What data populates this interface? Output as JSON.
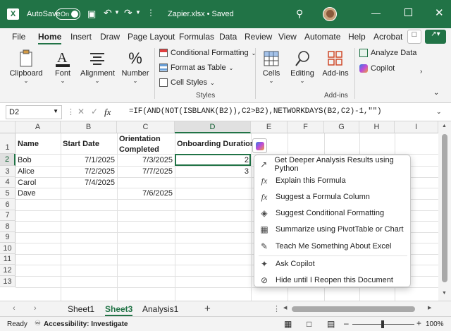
{
  "titlebar": {
    "autosave_label": "AutoSave",
    "autosave_state": "On",
    "doc_title": "Zapier.xlsx • Saved"
  },
  "menu_tabs": [
    "File",
    "Home",
    "Insert",
    "Draw",
    "Page Layout",
    "Formulas",
    "Data",
    "Review",
    "View",
    "Automate",
    "Help",
    "Acrobat"
  ],
  "ribbon": {
    "clipboard": "Clipboard",
    "font": "Font",
    "alignment": "Alignment",
    "number": "Number",
    "cond_format": "Conditional Formatting",
    "format_table": "Format as Table",
    "cell_styles": "Cell Styles",
    "styles_group": "Styles",
    "cells": "Cells",
    "editing": "Editing",
    "addins": "Add-ins",
    "analyze": "Analyze Data",
    "copilot": "Copilot",
    "addins_group": "Add-ins"
  },
  "formula_bar": {
    "name_box": "D2",
    "fx": "fx",
    "formula": "=IF(AND(NOT(ISBLANK(B2)),C2>B2),NETWORKDAYS(B2,C2)-1,\"\")"
  },
  "grid": {
    "columns": [
      "A",
      "B",
      "C",
      "D",
      "E",
      "F",
      "G",
      "H",
      "I"
    ],
    "rows": [
      "1",
      "2",
      "3",
      "4",
      "5",
      "6",
      "7",
      "8",
      "9",
      "10",
      "11",
      "12",
      "13"
    ],
    "header": {
      "a": "Name",
      "b": "Start Date",
      "c1": "Orientation",
      "c2": "Completed",
      "d": "Onboarding Duration"
    },
    "r2": {
      "a": "Bob",
      "b": "7/1/2025",
      "c": "7/3/2025",
      "d": "2"
    },
    "r3": {
      "a": "Alice",
      "b": "7/2/2025",
      "c": "7/7/2025",
      "d": "3"
    },
    "r4": {
      "a": "Carol",
      "b": "7/4/2025"
    },
    "r5": {
      "a": "Dave",
      "c": "7/6/2025"
    }
  },
  "copilot_menu": [
    "Get Deeper Analysis Results using Python",
    "Explain this Formula",
    "Suggest a Formula Column",
    "Suggest Conditional Formatting",
    "Summarize using PivotTable or Chart",
    "Teach Me Something About Excel",
    "Ask Copilot",
    "Hide until I Reopen this Document"
  ],
  "sheets": [
    "Sheet1",
    "Sheet3",
    "Analysis1"
  ],
  "status": {
    "ready": "Ready",
    "accessibility": "Accessibility: Investigate",
    "zoom": "100%"
  }
}
